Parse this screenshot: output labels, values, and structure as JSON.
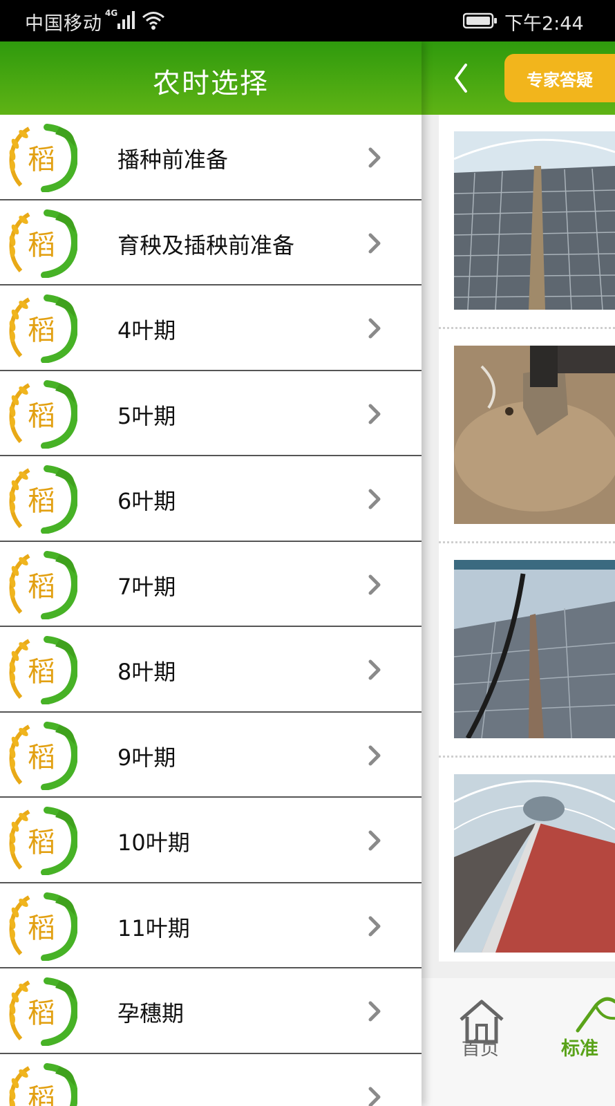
{
  "status_bar": {
    "carrier": "中国移动",
    "network": "4G",
    "time": "下午2:44"
  },
  "drawer": {
    "title": "农时选择",
    "logo_char": "稻",
    "items": [
      {
        "label": "播种前准备"
      },
      {
        "label": "育秧及插秧前准备"
      },
      {
        "label": "4叶期"
      },
      {
        "label": "5叶期"
      },
      {
        "label": "6叶期"
      },
      {
        "label": "7叶期"
      },
      {
        "label": "8叶期"
      },
      {
        "label": "9叶期"
      },
      {
        "label": "10叶期"
      },
      {
        "label": "11叶期"
      },
      {
        "label": "孕穗期"
      }
    ]
  },
  "background_page": {
    "expert_button": "专家答疑",
    "tabs": [
      {
        "label": "首页",
        "icon": "home-icon"
      },
      {
        "label": "标准",
        "icon": "standard-icon"
      }
    ]
  },
  "colors": {
    "header_green": "#3fa112",
    "accent_yellow": "#f2b51c",
    "active_tab_green": "#5aa31a"
  }
}
